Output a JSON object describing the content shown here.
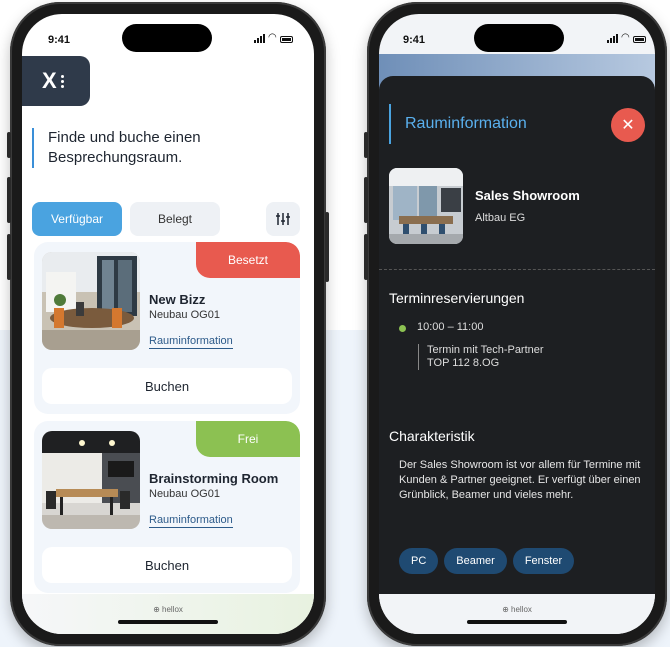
{
  "left_phone": {
    "status": {
      "time": "9:41"
    },
    "logo": {
      "letter": "X"
    },
    "headline": "Finde und buche einen Besprechungsraum.",
    "filters": {
      "available": "Verfügbar",
      "occupied": "Belegt"
    },
    "rooms": [
      {
        "status": "Besetzt",
        "name": "New Bizz",
        "location": "Neubau OG01",
        "info_link": "Rauminformation",
        "book_label": "Buchen"
      },
      {
        "status": "Frei",
        "name": "Brainstorming Room",
        "location": "Neubau OG01",
        "info_link": "Rauminformation",
        "book_label": "Buchen"
      }
    ],
    "footer": "⊕ hellox"
  },
  "right_phone": {
    "status": {
      "time": "9:41"
    },
    "title": "Rauminformation",
    "close_icon": "close-icon",
    "room": {
      "name": "Sales Showroom",
      "location": "Altbau EG"
    },
    "reservations": {
      "heading": "Terminreservierungen",
      "slot_time": "10:00 – 11:00",
      "slot_title": "Termin mit Tech-Partner",
      "slot_place": "TOP 112 8.OG"
    },
    "characteristics": {
      "heading": "Charakteristik",
      "description": "Der Sales Showroom ist vor allem für Termine mit Kunden & Partner geeignet. Er verfügt über einen Grünblick, Beamer und vieles mehr.",
      "tags": [
        "PC",
        "Beamer",
        "Fenster"
      ]
    },
    "footer": "⊕ hellox"
  },
  "colors": {
    "accent_blue": "#4aa3e0",
    "busy_red": "#e85a4f",
    "free_green": "#8cc152",
    "dark_sheet": "#1d1f22",
    "logo_bg": "#2f3a4a"
  }
}
